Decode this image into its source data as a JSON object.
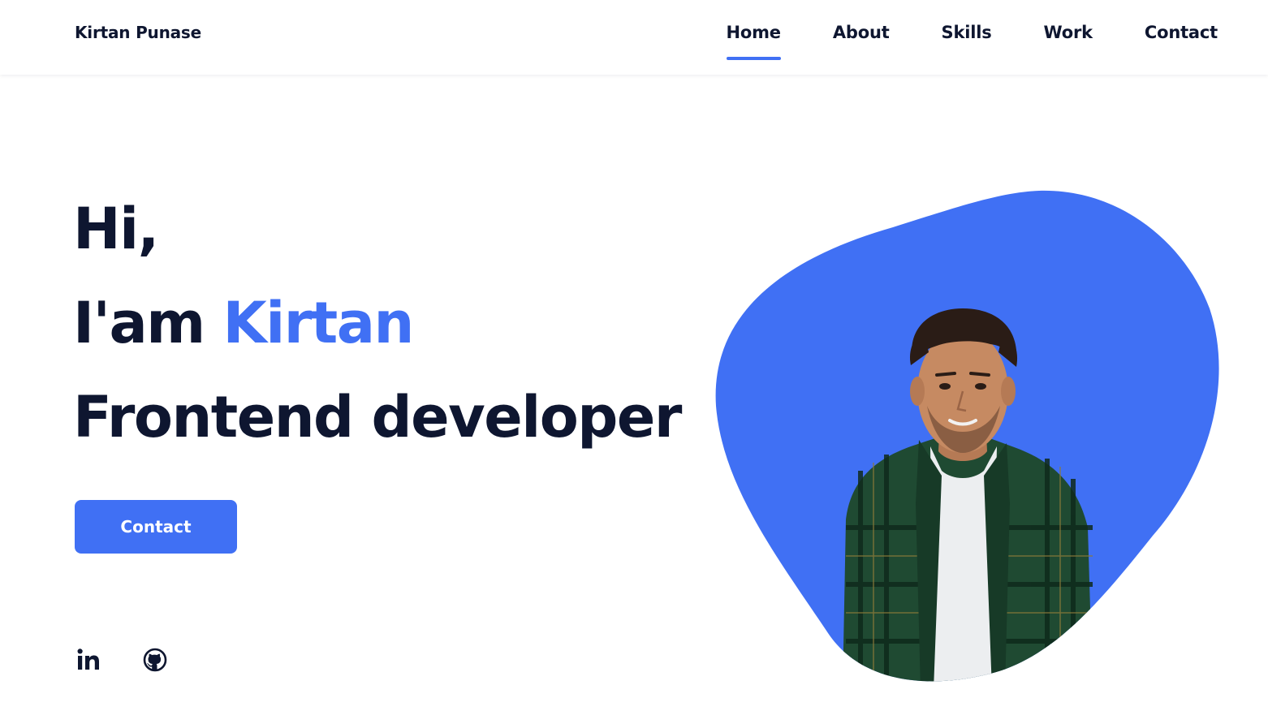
{
  "header": {
    "logo": "Kirtan Punase",
    "nav": [
      {
        "label": "Home",
        "active": true
      },
      {
        "label": "About",
        "active": false
      },
      {
        "label": "Skills",
        "active": false
      },
      {
        "label": "Work",
        "active": false
      },
      {
        "label": "Contact",
        "active": false
      }
    ]
  },
  "hero": {
    "greeting": "Hi,",
    "intro_prefix": "I'am",
    "name": "Kirtan",
    "role": "Frontend developer",
    "button_label": "Contact"
  },
  "social": [
    {
      "icon": "linkedin-icon"
    },
    {
      "icon": "github-icon"
    }
  ],
  "colors": {
    "accent": "#4070f4",
    "text": "#0e1630",
    "background": "#ffffff"
  }
}
